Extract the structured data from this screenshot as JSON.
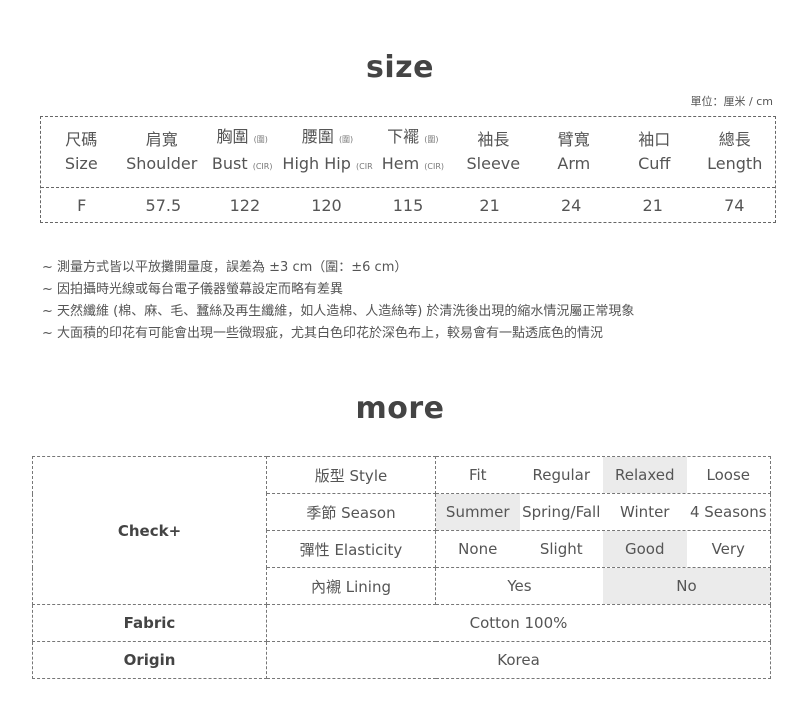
{
  "size": {
    "title": "size",
    "unit": "單位：厘米 / cm",
    "columns": [
      {
        "zh": "尺碼",
        "en": "Size",
        "tag": ""
      },
      {
        "zh": "肩寬",
        "en": "Shoulder",
        "tag": ""
      },
      {
        "zh": "胸圍",
        "zh_tag": "(圍)",
        "en": "Bust",
        "tag": "(CIR)"
      },
      {
        "zh": "腰圍",
        "zh_tag": "(圍)",
        "en": "High Hip",
        "tag": "(CIR"
      },
      {
        "zh": "下襬",
        "zh_tag": "(圍)",
        "en": "Hem",
        "tag": "(CIR)"
      },
      {
        "zh": "袖長",
        "en": "Sleeve",
        "tag": ""
      },
      {
        "zh": "臂寬",
        "en": "Arm",
        "tag": ""
      },
      {
        "zh": "袖口",
        "en": "Cuff",
        "tag": ""
      },
      {
        "zh": "總長",
        "en": "Length",
        "tag": ""
      }
    ],
    "values": [
      "F",
      "57.5",
      "122",
      "120",
      "115",
      "21",
      "24",
      "21",
      "74"
    ]
  },
  "notes": [
    "~ 測量方式皆以平放攤開量度，誤差為 ±3 cm（圍：±6 cm）",
    "~ 因拍攝時光線或每台電子儀器螢幕設定而略有差異",
    "~ 天然纖維 (棉、麻、毛、蠶絲及再生纖維，如人造棉、人造絲等) 於清洗後出現的縮水情況屬正常現象",
    "~ 大面積的印花有可能會出現一些微瑕疵，尤其白色印花於深色布上，較易會有一點透底色的情況"
  ],
  "more": {
    "title": "more",
    "check_label": "Check+",
    "rows": [
      {
        "label": "版型 Style",
        "options": [
          "Fit",
          "Regular",
          "Relaxed",
          "Loose"
        ],
        "selected": 2
      },
      {
        "label": "季節 Season",
        "options": [
          "Summer",
          "Spring/Fall",
          "Winter",
          "4 Seasons"
        ],
        "selected": 0
      },
      {
        "label": "彈性 Elasticity",
        "options": [
          "None",
          "Slight",
          "Good",
          "Very"
        ],
        "selected": 2
      },
      {
        "label": "內襯 Lining",
        "options": [
          "Yes",
          "No"
        ],
        "selected": 1
      }
    ],
    "fabric_label": "Fabric",
    "fabric_value": "Cotton 100%",
    "origin_label": "Origin",
    "origin_value": "Korea",
    "selected_color": "#ebebeb"
  }
}
